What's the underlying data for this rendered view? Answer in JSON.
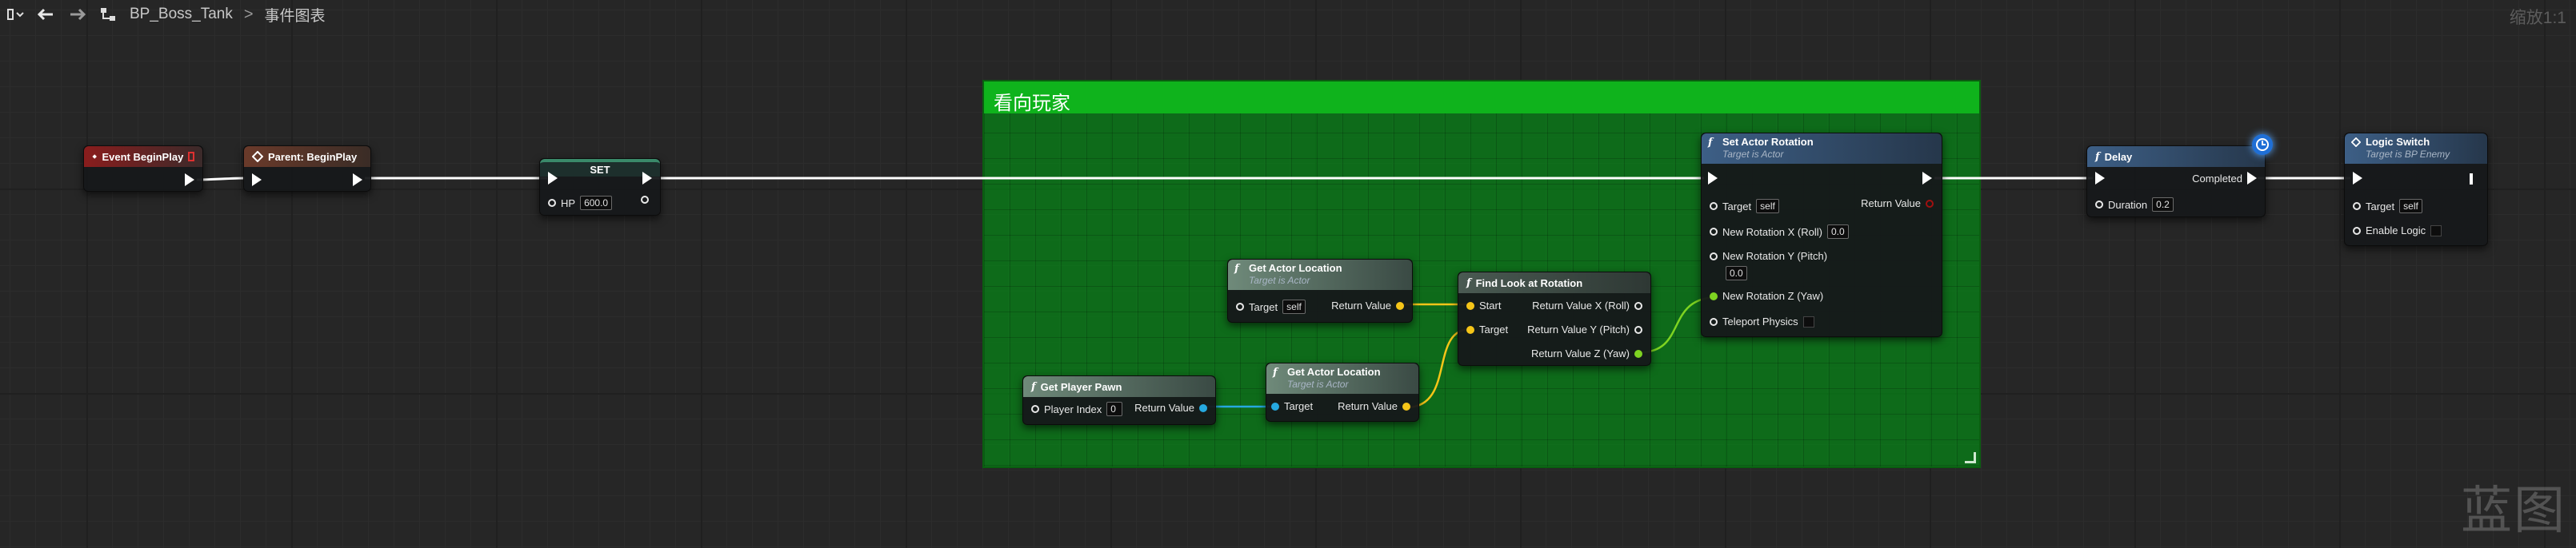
{
  "toolbar": {
    "crumb_blueprint": "BP_Boss_Tank",
    "crumb_graph": "事件图表",
    "zoom": "缩放1:1"
  },
  "watermark": "蓝图",
  "comment": {
    "title": "看向玩家"
  },
  "nodes": {
    "event_begin_play": {
      "title": "Event BeginPlay"
    },
    "parent_begin_play": {
      "title": "Parent: BeginPlay"
    },
    "set": {
      "title": "SET",
      "hp_label": "HP",
      "hp_value": "600.0"
    },
    "get_actor_location_1": {
      "title": "Get Actor Location",
      "subtitle": "Target is Actor",
      "target_label": "Target",
      "target_value": "self",
      "return_label": "Return Value"
    },
    "get_player_pawn": {
      "title": "Get Player Pawn",
      "player_index_label": "Player Index",
      "player_index_value": "0",
      "return_label": "Return Value"
    },
    "get_actor_location_2": {
      "title": "Get Actor Location",
      "subtitle": "Target is Actor",
      "target_label": "Target",
      "return_label": "Return Value"
    },
    "find_look_at": {
      "title": "Find Look at Rotation",
      "start_label": "Start",
      "target_label": "Target",
      "ret_x": "Return Value X (Roll)",
      "ret_y": "Return Value Y (Pitch)",
      "ret_z": "Return Value Z (Yaw)"
    },
    "set_actor_rotation": {
      "title": "Set Actor Rotation",
      "subtitle": "Target is Actor",
      "target_label": "Target",
      "target_value": "self",
      "return_label": "Return Value",
      "rot_x_label": "New Rotation X (Roll)",
      "rot_x_value": "0.0",
      "rot_y_label": "New Rotation Y (Pitch)",
      "rot_y_value": "0.0",
      "rot_z_label": "New Rotation Z (Yaw)",
      "teleport_label": "Teleport Physics"
    },
    "delay": {
      "title": "Delay",
      "completed_label": "Completed",
      "duration_label": "Duration",
      "duration_value": "0.2"
    },
    "logic_switch": {
      "title": "Logic Switch",
      "subtitle": "Target is BP Enemy",
      "target_label": "Target",
      "target_value": "self",
      "enable_label": "Enable Logic"
    }
  },
  "colors": {
    "exec_wire": "#ffffff",
    "vector_wire": "#f5c518",
    "object_wire": "#26a9e0",
    "float_wire": "#7ed321",
    "comment_fill": "#0fb31c"
  }
}
